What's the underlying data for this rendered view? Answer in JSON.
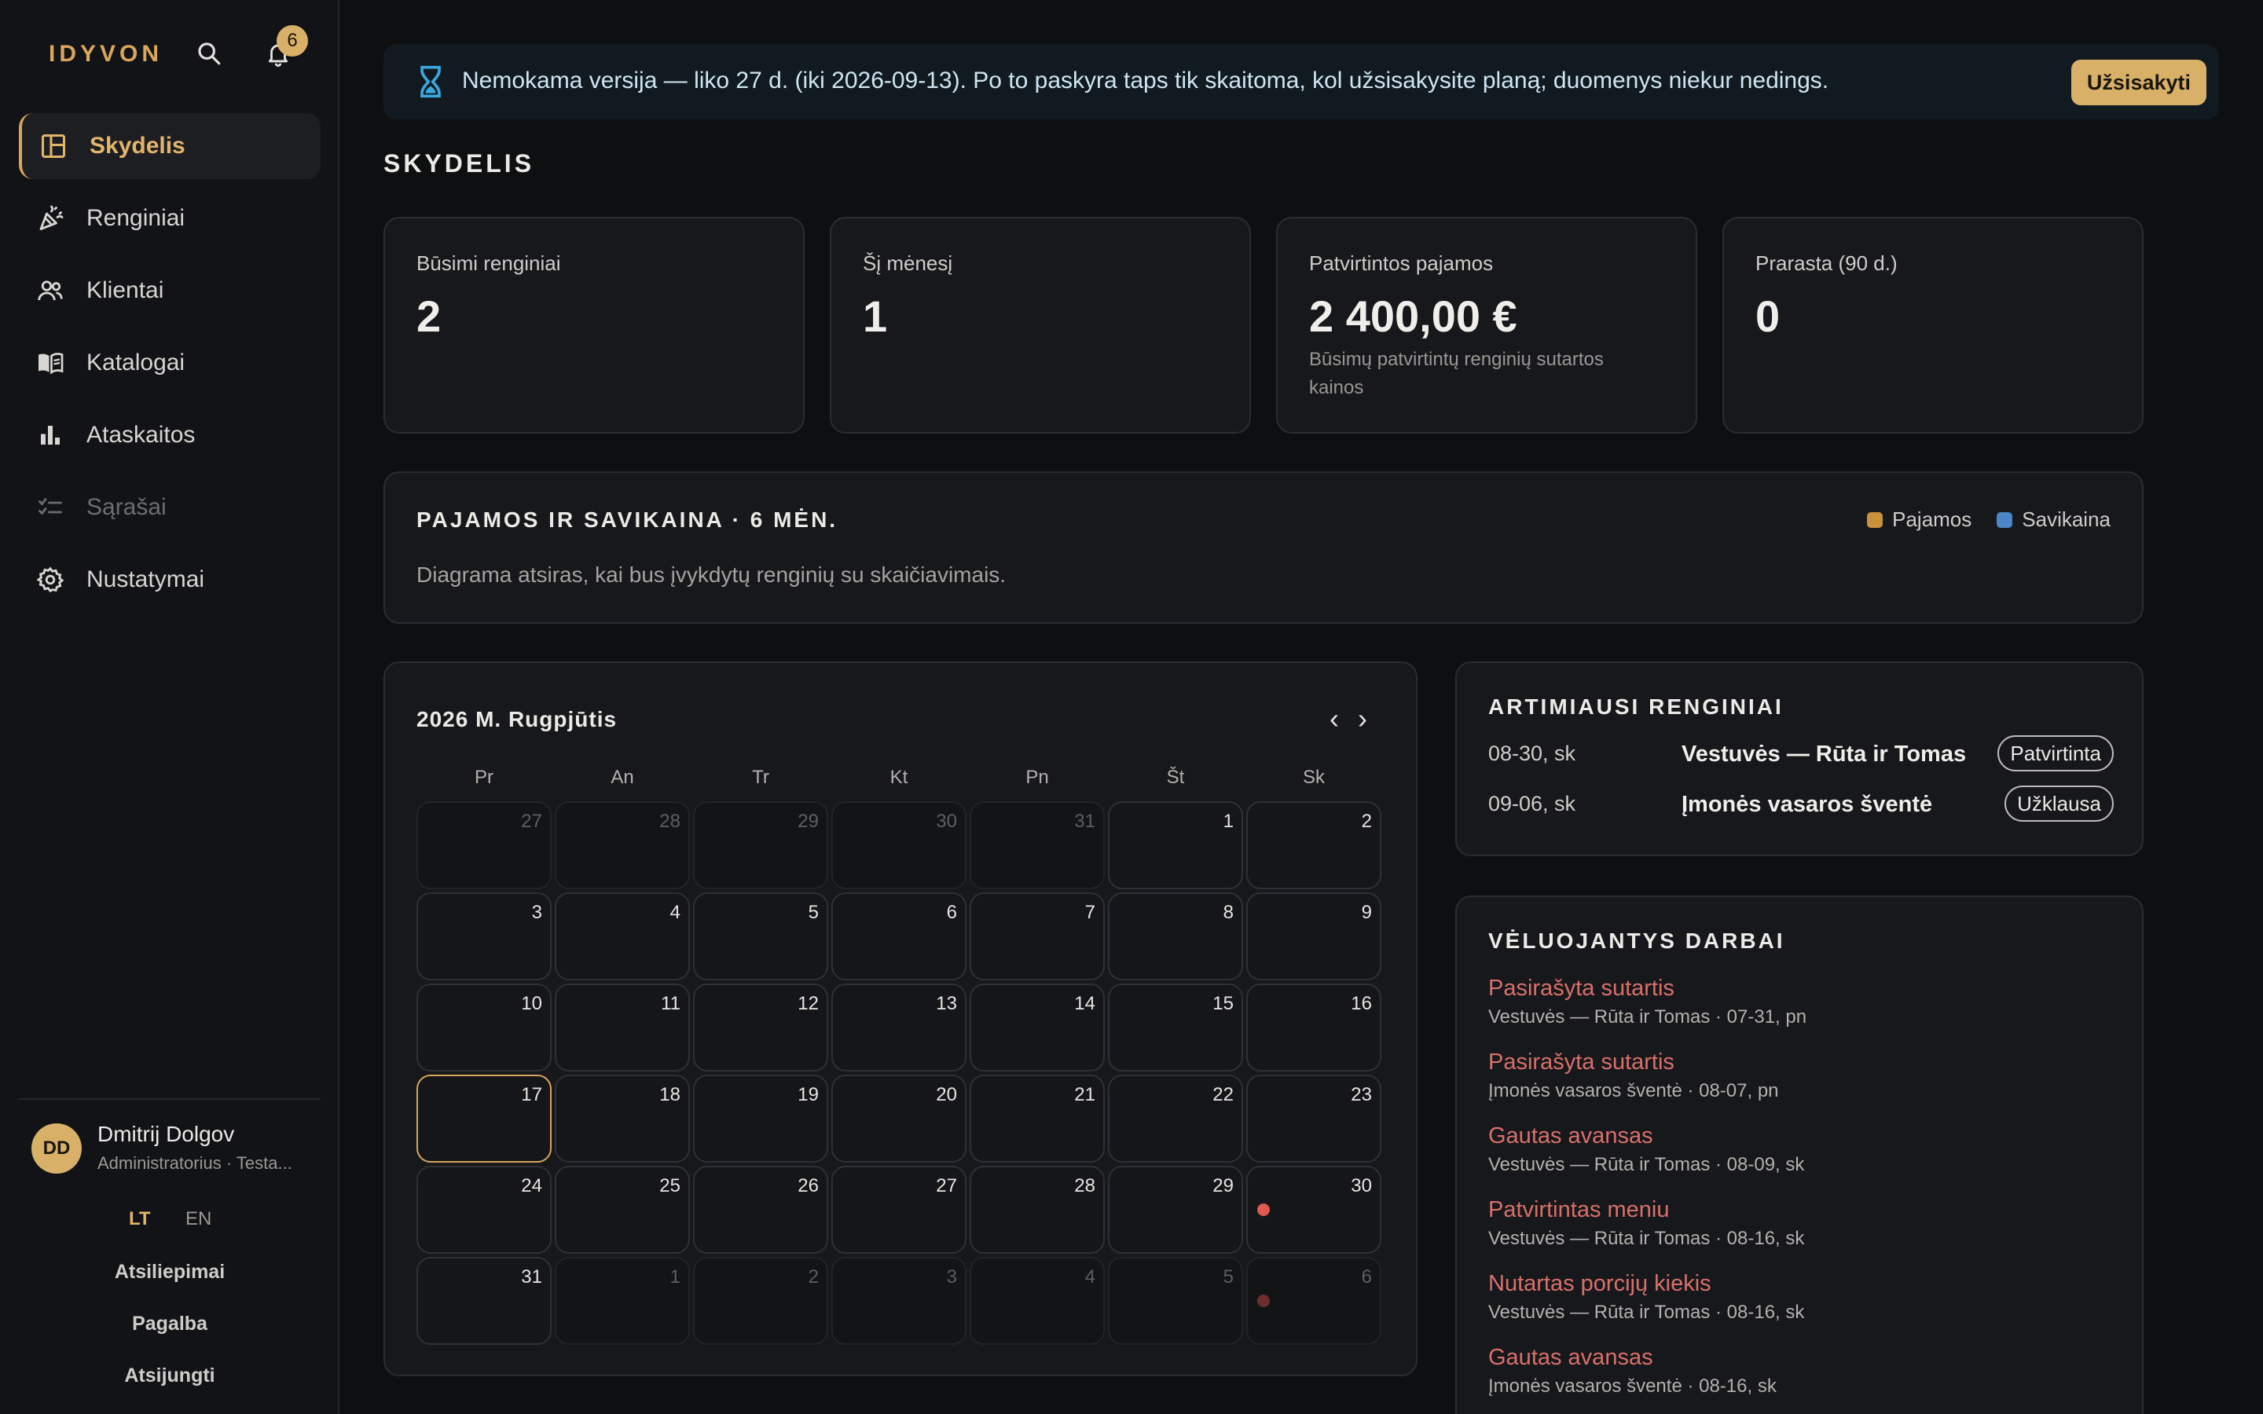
{
  "app": {
    "brand": "IDYVON",
    "notification_count": "6"
  },
  "sidebar": {
    "items": [
      {
        "label": "Skydelis",
        "icon": "dashboard-icon",
        "active": true
      },
      {
        "label": "Renginiai",
        "icon": "party-popper-icon"
      },
      {
        "label": "Klientai",
        "icon": "users-icon"
      },
      {
        "label": "Katalogai",
        "icon": "book-open-icon"
      },
      {
        "label": "Ataskaitos",
        "icon": "bar-chart-icon"
      },
      {
        "label": "Sąrašai",
        "icon": "checklist-icon",
        "disabled": true
      },
      {
        "label": "Nustatymai",
        "icon": "gear-icon"
      }
    ],
    "user": {
      "initials": "DD",
      "name": "Dmitrij Dolgov",
      "role": "Administratorius · Testa..."
    },
    "languages": {
      "lt": "LT",
      "en": "EN",
      "selected": "LT"
    },
    "links": {
      "feedback": "Atsiliepimai",
      "help": "Pagalba",
      "logout": "Atsijungti"
    }
  },
  "banner": {
    "text": "Nemokama versija — liko 27 d. (iki 2026-09-13). Po to paskyra taps tik skaitoma, kol užsisakysite planą; duomenys niekur nedings.",
    "button": "Užsisakyti",
    "icon": "hourglass-icon"
  },
  "page": {
    "title": "SKYDELIS"
  },
  "stats": [
    {
      "label": "Būsimi renginiai",
      "value": "2",
      "note": ""
    },
    {
      "label": "Šį mėnesį",
      "value": "1",
      "note": ""
    },
    {
      "label": "Patvirtintos pajamos",
      "value": "2 400,00 €",
      "note": "Būsimų patvirtintų renginių sutartos kainos"
    },
    {
      "label": "Prarasta (90 d.)",
      "value": "0",
      "note": ""
    }
  ],
  "revenue": {
    "title": "PAJAMOS IR SAVIKAINA · 6 MĖN.",
    "legend": [
      {
        "label": "Pajamos",
        "color": "#c9923a"
      },
      {
        "label": "Savikaina",
        "color": "#4a86c8"
      }
    ],
    "empty": "Diagrama atsiras, kai bus įvykdytų renginių su skaičiavimais."
  },
  "calendar": {
    "title": "2026 M. Rugpjūtis",
    "prev": "‹",
    "next": "›",
    "weekdays": [
      "Pr",
      "An",
      "Tr",
      "Kt",
      "Pn",
      "Št",
      "Sk"
    ],
    "days": [
      {
        "n": "27",
        "other": true
      },
      {
        "n": "28",
        "other": true
      },
      {
        "n": "29",
        "other": true
      },
      {
        "n": "30",
        "other": true
      },
      {
        "n": "31",
        "other": true
      },
      {
        "n": "1"
      },
      {
        "n": "2"
      },
      {
        "n": "3"
      },
      {
        "n": "4"
      },
      {
        "n": "5"
      },
      {
        "n": "6"
      },
      {
        "n": "7"
      },
      {
        "n": "8"
      },
      {
        "n": "9"
      },
      {
        "n": "10"
      },
      {
        "n": "11"
      },
      {
        "n": "12"
      },
      {
        "n": "13"
      },
      {
        "n": "14"
      },
      {
        "n": "15"
      },
      {
        "n": "16"
      },
      {
        "n": "17",
        "today": true
      },
      {
        "n": "18"
      },
      {
        "n": "19"
      },
      {
        "n": "20"
      },
      {
        "n": "21"
      },
      {
        "n": "22"
      },
      {
        "n": "23"
      },
      {
        "n": "24"
      },
      {
        "n": "25"
      },
      {
        "n": "26"
      },
      {
        "n": "27"
      },
      {
        "n": "28"
      },
      {
        "n": "29"
      },
      {
        "n": "30",
        "event": true
      },
      {
        "n": "31"
      },
      {
        "n": "1",
        "other": true
      },
      {
        "n": "2",
        "other": true
      },
      {
        "n": "3",
        "other": true
      },
      {
        "n": "4",
        "other": true
      },
      {
        "n": "5",
        "other": true
      },
      {
        "n": "6",
        "other": true,
        "event": true
      }
    ]
  },
  "upcoming": {
    "title": "ARTIMIAUSI RENGINIAI",
    "items": [
      {
        "date": "08-30, sk",
        "title": "Vestuvės — Rūta ir Tomas",
        "status": "Patvirtinta"
      },
      {
        "date": "09-06, sk",
        "title": "Įmonės vasaros šventė",
        "status": "Užklausa"
      }
    ]
  },
  "overdue": {
    "title": "VĖLUOJANTYS DARBAI",
    "items": [
      {
        "title": "Pasirašyta sutartis",
        "sub": "Vestuvės — Rūta ir Tomas · 07-31, pn"
      },
      {
        "title": "Pasirašyta sutartis",
        "sub": "Įmonės vasaros šventė · 08-07, pn"
      },
      {
        "title": "Gautas avansas",
        "sub": "Vestuvės — Rūta ir Tomas · 08-09, sk"
      },
      {
        "title": "Patvirtintas meniu",
        "sub": "Vestuvės — Rūta ir Tomas · 08-16, sk"
      },
      {
        "title": "Nutartas porcijų kiekis",
        "sub": "Vestuvės — Rūta ir Tomas · 08-16, sk"
      },
      {
        "title": "Gautas avansas",
        "sub": "Įmonės vasaros šventė · 08-16, sk"
      }
    ]
  }
}
